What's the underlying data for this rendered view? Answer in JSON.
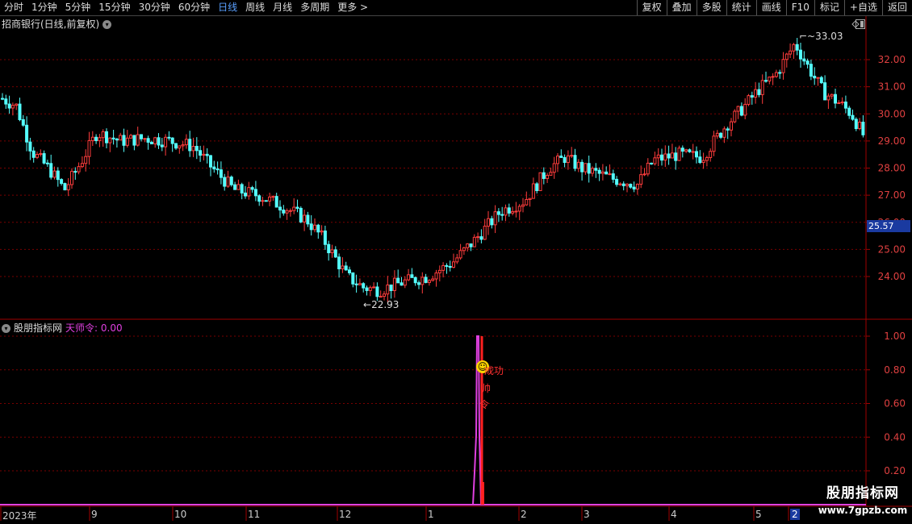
{
  "toolbar": {
    "periods": [
      "分时",
      "1分钟",
      "5分钟",
      "15分钟",
      "30分钟",
      "60分钟",
      "日线",
      "周线",
      "月线",
      "多周期",
      "更多 >"
    ],
    "active_period": "日线",
    "buttons": [
      "复权",
      "叠加",
      "多股",
      "统计",
      "画线",
      "F10",
      "标记",
      "+自选",
      "返回"
    ]
  },
  "stock": {
    "title": "招商银行(日线,前复权)"
  },
  "price_axis": {
    "ticks": [
      "32.00",
      "31.00",
      "30.00",
      "29.00",
      "28.00",
      "27.00",
      "26.00",
      "25.00",
      "24.00"
    ],
    "current_price": "25.57",
    "high_label": "33.03",
    "low_label": "22.93"
  },
  "indicator": {
    "name": "股朋指标网",
    "value_text": "天师令: 0.00",
    "axis_ticks": [
      "1.00",
      "0.80",
      "0.60",
      "0.40",
      "0.20"
    ],
    "signal_chars": [
      "成功",
      "帅",
      "令"
    ]
  },
  "time_axis": {
    "labels": [
      "2023年",
      "9",
      "10",
      "11",
      "12",
      "1",
      "2",
      "3",
      "4",
      "5",
      "2"
    ]
  },
  "watermark": {
    "title": "股朋指标网",
    "url": "www.7gpzb.com"
  },
  "colors": {
    "up": "#ff3c3c",
    "down": "#54ffff",
    "grid": "#8b0000",
    "indicator": "#e040e0"
  }
}
